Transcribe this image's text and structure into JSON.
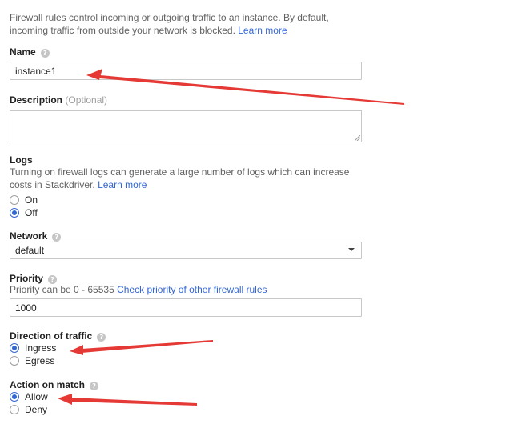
{
  "intro": {
    "line1": "Firewall rules control incoming or outgoing traffic to an instance. By default,",
    "line2": "incoming traffic from outside your network is blocked.",
    "learn_more": "Learn more"
  },
  "name": {
    "label": "Name",
    "value": "instance1"
  },
  "description": {
    "label": "Description",
    "optional": "(Optional)",
    "value": ""
  },
  "logs": {
    "label": "Logs",
    "help_line1": "Turning on firewall logs can generate a large number of logs which can increase",
    "help_line2": "costs in Stackdriver.",
    "learn_more": "Learn more",
    "options": [
      {
        "label": "On",
        "checked": false
      },
      {
        "label": "Off",
        "checked": true
      }
    ]
  },
  "network": {
    "label": "Network",
    "value": "default"
  },
  "priority": {
    "label": "Priority",
    "help": "Priority can be 0 - 65535",
    "link": "Check priority of other firewall rules",
    "value": "1000"
  },
  "direction": {
    "label": "Direction of traffic",
    "options": [
      {
        "label": "Ingress",
        "checked": true
      },
      {
        "label": "Egress",
        "checked": false
      }
    ]
  },
  "action": {
    "label": "Action on match",
    "options": [
      {
        "label": "Allow",
        "checked": true
      },
      {
        "label": "Deny",
        "checked": false
      }
    ]
  },
  "colors": {
    "link": "#3367d6",
    "annotation_arrow": "#e53935",
    "radio_checked": "#3367d6"
  },
  "help_icon_glyph": "?"
}
